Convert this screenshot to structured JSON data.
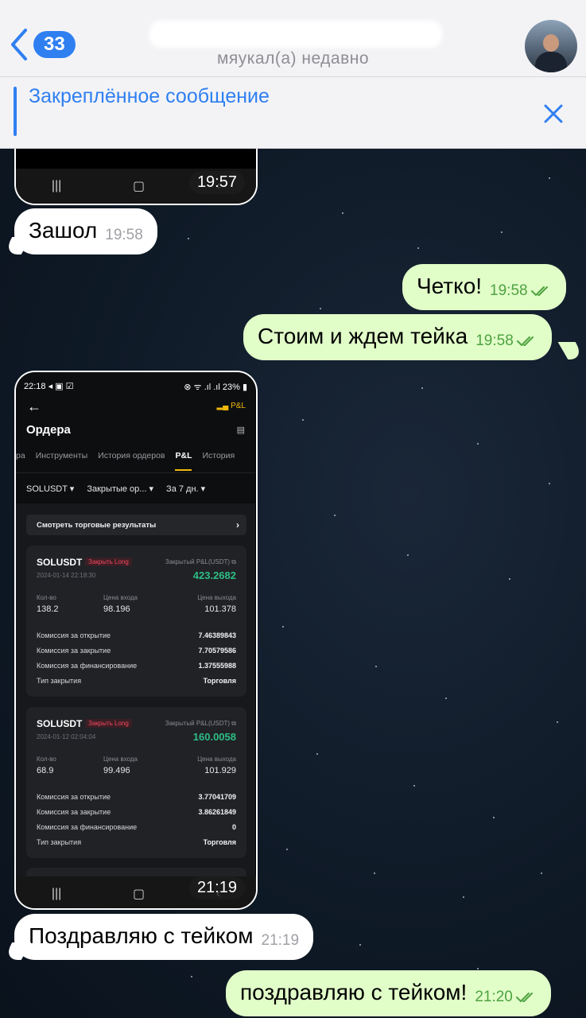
{
  "header": {
    "back_count": "33",
    "status": "мяукал(а) недавно"
  },
  "pinned": {
    "title": "Закреплённое сообщение"
  },
  "messages": {
    "shot1_time": "19:57",
    "m1": {
      "text": "Зашол",
      "time": "19:58"
    },
    "m2": {
      "text": "Четко!",
      "time": "19:58"
    },
    "m3": {
      "text": "Стоим и ждем тейка",
      "time": "19:58"
    },
    "shot2_time": "21:19",
    "m4": {
      "text": "Поздравляю с  тейком",
      "time": "21:19"
    },
    "m5": {
      "text": "поздравляю с тейком!",
      "time": "21:20"
    }
  },
  "phone": {
    "status_time": "22:18",
    "battery": "23%",
    "pnl_link": "P&L",
    "title": "Ордера",
    "tabs": [
      "ра",
      "Инструменты",
      "История ордеров",
      "P&L",
      "История"
    ],
    "filters": [
      "SOLUSDT ▾",
      "Закрытые ор... ▾",
      "За 7 дн. ▾"
    ],
    "results_label": "Смотреть торговые результаты",
    "labels": {
      "closed_pnl": "Закрытый P&L(USDT)",
      "qty": "Кол-во",
      "entry": "Цена входа",
      "exit": "Цена выхода",
      "open_fee": "Комиссия за открытие",
      "close_fee": "Комиссия за закрытие",
      "funding_fee": "Комиссия за финансирование",
      "close_type": "Тип закрытия"
    },
    "cards": [
      {
        "symbol": "SOLUSDT",
        "tag": "Закрыть Long",
        "datetime": "2024-01-14 22:18:30",
        "pnl": "423.2682",
        "qty": "138.2",
        "entry": "98.196",
        "exit": "101.378",
        "open_fee": "7.46389843",
        "close_fee": "7.70579586",
        "funding_fee": "1.37555988",
        "close_type": "Торговля"
      },
      {
        "symbol": "SOLUSDT",
        "tag": "Закрыть Long",
        "datetime": "2024-01-12 02:04:04",
        "pnl": "160.0058",
        "qty": "68.9",
        "entry": "99.496",
        "exit": "101.929",
        "open_fee": "3.77041709",
        "close_fee": "3.86261849",
        "funding_fee": "0",
        "close_type": "Торговля"
      }
    ]
  },
  "colors": {
    "accent": "#2f7ff1",
    "outgoing_bubble": "#e1fdc8",
    "incoming_bubble": "#ffffff",
    "read_check": "#4ea341",
    "profit": "#2ebd85",
    "exchange_yellow": "#f0b90b"
  },
  "icons": {
    "back": "chevron-left-icon",
    "close": "close-icon",
    "read": "double-check-icon"
  }
}
